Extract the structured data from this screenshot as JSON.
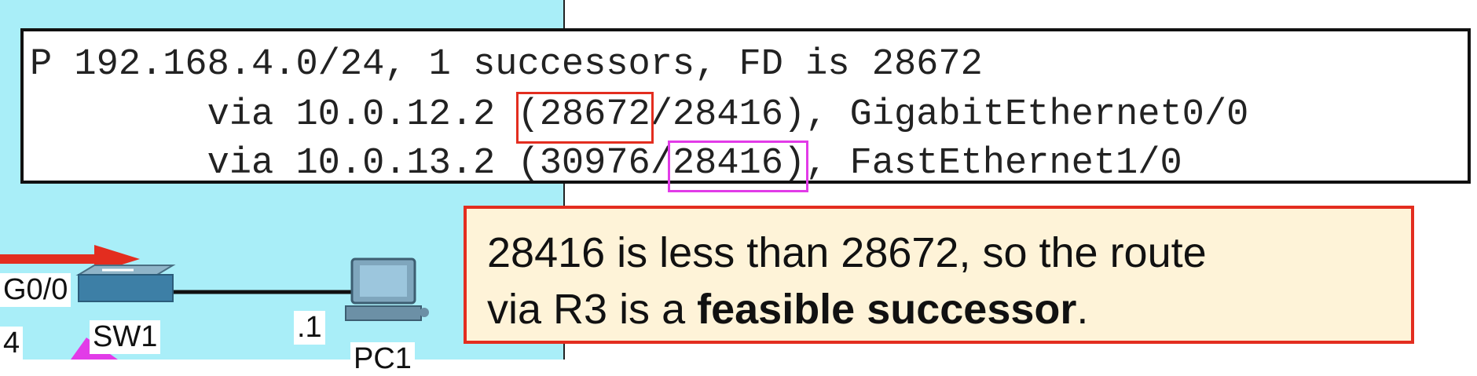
{
  "terminal": {
    "line1": "P 192.168.4.0/24, 1 successors, FD is 28672",
    "line2": {
      "pre": "        via 10.0.12.2 ",
      "fd": "(28672",
      "mid": "/",
      "rd": "28416",
      "post": "), GigabitEthernet0/0"
    },
    "line3": {
      "pre": "        via 10.0.13.2 (30976/",
      "rd": "28416)",
      "post": ", FastEthernet1/0"
    }
  },
  "callout": {
    "text1": "28416 is less than 28672, so the route",
    "text2": "via R3 is a ",
    "bold": "feasible successor",
    "text3": "."
  },
  "network": {
    "interface_label": "G0/0",
    "switch_label": "SW1",
    "pc_label": "PC1",
    "host_addr": ".1",
    "edge_label": "4"
  },
  "colors": {
    "canvas_bg": "#a9eef8",
    "highlight_fd": "#e32d1f",
    "highlight_rd": "#e23be8",
    "callout_bg": "#fef3d8",
    "callout_border": "#e32d1f"
  }
}
